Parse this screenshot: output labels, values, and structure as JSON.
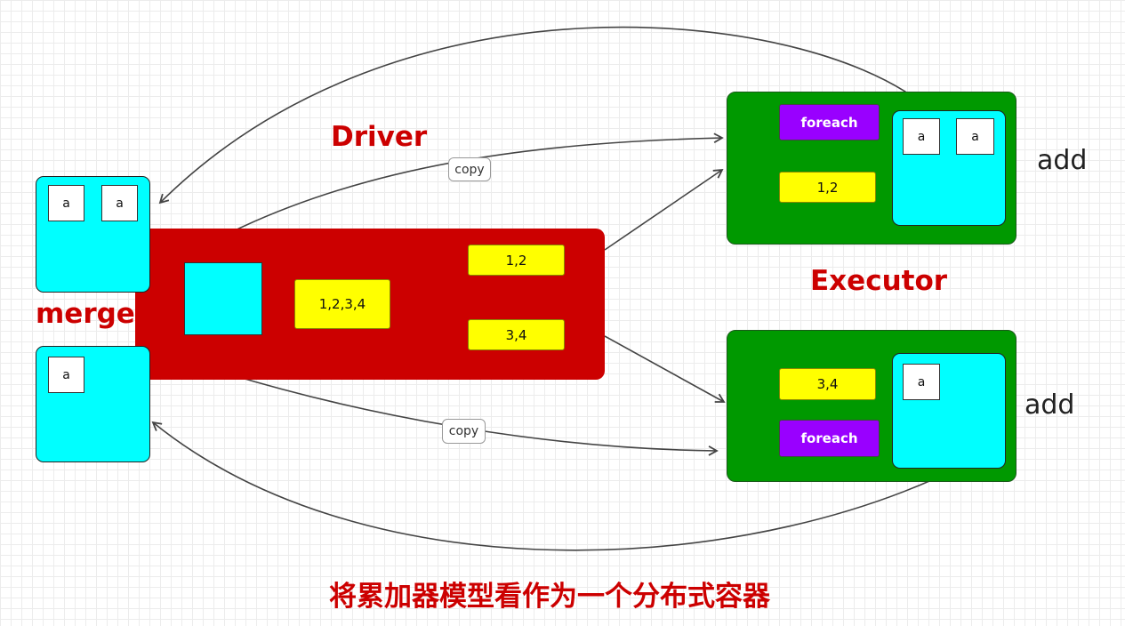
{
  "labels": {
    "driver": "Driver",
    "executor": "Executor",
    "merge": "merge",
    "add_top": "add",
    "add_bottom": "add",
    "copy_top": "copy",
    "copy_bottom": "copy",
    "caption": "将累加器模型看作为一个分布式容器"
  },
  "driver": {
    "data": "1,2,3,4",
    "partition_1": "1,2",
    "partition_2": "3,4"
  },
  "merge_boxes": {
    "top": [
      "a",
      "a"
    ],
    "bottom": [
      "a"
    ]
  },
  "executor_top": {
    "op": "foreach",
    "partition": "1,2",
    "items": [
      "a",
      "a"
    ]
  },
  "executor_bottom": {
    "op": "foreach",
    "partition": "3,4",
    "items": [
      "a"
    ]
  },
  "colors": {
    "driver": "#cc0000",
    "executor": "#009900",
    "accumulator": "#00ffff",
    "partition": "#ffff00",
    "operation": "#9900ff",
    "label": "#cc0000"
  }
}
